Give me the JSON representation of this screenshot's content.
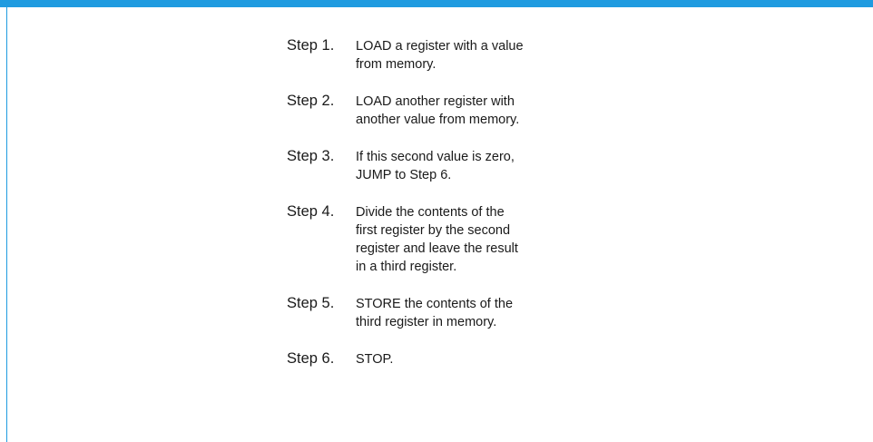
{
  "steps": [
    {
      "label": "Step 1.",
      "lines": [
        "LOAD a register with a value",
        "from memory."
      ]
    },
    {
      "label": "Step 2.",
      "lines": [
        "LOAD another register with",
        "another value from memory."
      ]
    },
    {
      "label": "Step 3.",
      "lines": [
        "If this second value is zero,",
        "JUMP to Step 6."
      ]
    },
    {
      "label": "Step 4.",
      "lines": [
        "Divide the contents of the",
        "first register by the second",
        "register and leave the result",
        "in a third register."
      ]
    },
    {
      "label": "Step 5.",
      "lines": [
        "STORE the contents of the",
        "third register in memory."
      ]
    },
    {
      "label": "Step 6.",
      "lines": [
        "STOP."
      ]
    }
  ],
  "colors": {
    "accent": "#1f9be0",
    "text": "#1a1a1a",
    "background": "#ffffff"
  }
}
